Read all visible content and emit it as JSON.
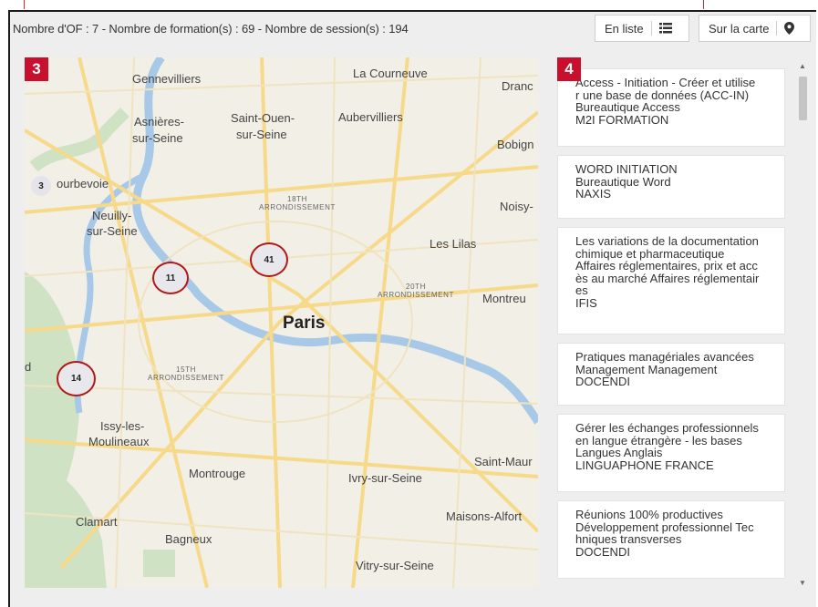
{
  "summary": "Nombre d'OF : 7 - Nombre de formation(s) : 69 - Nombre de session(s) : 194",
  "buttons": {
    "list_label": "En liste",
    "list_icon": "list-icon",
    "map_label": "Sur la carte",
    "map_icon": "map-pin-icon"
  },
  "badges": {
    "map": "3",
    "list": "4"
  },
  "map": {
    "places": [
      "Gennevilliers",
      "La Courneuve",
      "Dranc",
      "Asnières-",
      "sur-Seine",
      "Saint-Ouen-",
      "sur-Seine",
      "Aubervilliers",
      "Bobign",
      "ourbevoie",
      "Neuilly-",
      "sur-Seine",
      "Noisy-",
      "Les Lilas",
      "Montreu",
      "Paris",
      "d",
      "Issy-les-",
      "Moulineaux",
      "Montrouge",
      "Ivry-sur-Seine",
      "Saint-Maur",
      "Clamart",
      "Maisons-Alfort",
      "Bagneux",
      "Vitry-sur-Seine"
    ],
    "districts": [
      "18TH",
      "ARRONDISSEMENT",
      "20TH",
      "ARRONDISSEMENT",
      "15TH",
      "ARRONDISSEMENT"
    ],
    "clusters": [
      "3",
      "11",
      "41",
      "14"
    ]
  },
  "trainings": [
    {
      "lines": [
        "Access - Initiation - Créer et utilise",
        "r une base de données (ACC-IN)",
        "Bureautique Access",
        "M2I FORMATION"
      ]
    },
    {
      "lines": [
        "WORD INITIATION",
        "Bureautique Word",
        "NAXIS"
      ]
    },
    {
      "lines": [
        "Les variations de la documentation",
        "chimique et pharmaceutique",
        "Affaires réglementaires, prix et acc",
        "ès au marché Affaires réglementair",
        "es",
        "IFIS"
      ]
    },
    {
      "lines": [
        "Pratiques managériales avancées",
        "Management Management",
        "DOCENDI"
      ]
    },
    {
      "lines": [
        "Gérer les échanges professionnels",
        "en langue étrangère - les bases",
        "Langues Anglais",
        "LINGUAPHONE FRANCE"
      ]
    },
    {
      "lines": [
        "Réunions 100% productives",
        "Développement professionnel Tec",
        "hniques transverses",
        "DOCENDI"
      ]
    }
  ],
  "scrollbar": {
    "up": "▲",
    "down": "▼"
  }
}
